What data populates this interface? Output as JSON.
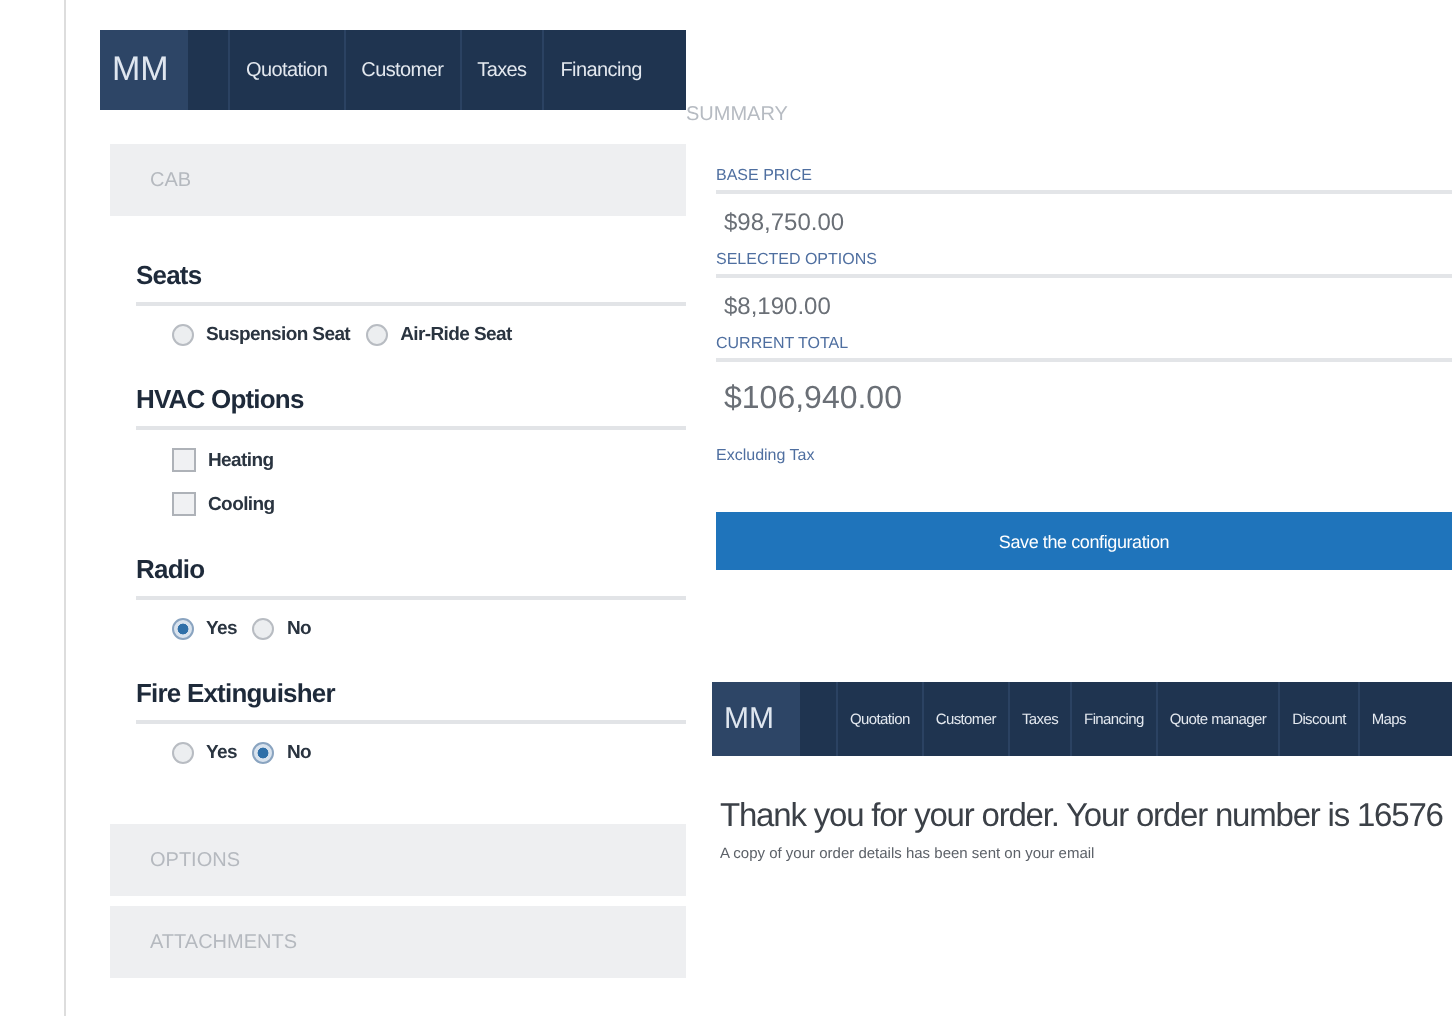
{
  "configurator": {
    "nav": {
      "logo": "MM",
      "items": [
        "Quotation",
        "Customer",
        "Taxes",
        "Financing"
      ]
    },
    "sections": [
      {
        "title": "CAB",
        "groups": [
          {
            "title": "Seats",
            "kind": "radio",
            "options": [
              {
                "label": "Suspension Seat",
                "selected": false
              },
              {
                "label": "Air-Ride Seat",
                "selected": false
              }
            ]
          },
          {
            "title": "HVAC Options",
            "kind": "checkbox",
            "options": [
              {
                "label": "Heating",
                "checked": false
              },
              {
                "label": "Cooling",
                "checked": false
              }
            ]
          },
          {
            "title": "Radio",
            "kind": "radio",
            "options": [
              {
                "label": "Yes",
                "selected": true
              },
              {
                "label": "No",
                "selected": false
              }
            ]
          },
          {
            "title": "Fire Extinguisher",
            "kind": "radio",
            "options": [
              {
                "label": "Yes",
                "selected": false
              },
              {
                "label": "No",
                "selected": true
              }
            ]
          }
        ]
      },
      {
        "title": "OPTIONS"
      },
      {
        "title": "ATTACHMENTS"
      }
    ]
  },
  "summary": {
    "title": "SUMMARY",
    "items": [
      {
        "label": "BASE PRICE",
        "value": "$98,750.00",
        "kind": "line"
      },
      {
        "label": "SELECTED OPTIONS",
        "value": "$8,190.00",
        "kind": "line"
      },
      {
        "label": "CURRENT TOTAL",
        "value": "$106,940.00",
        "kind": "total"
      }
    ],
    "note": "Excluding Tax",
    "button": "Save the configuration"
  },
  "confirmation": {
    "nav": {
      "logo": "MM",
      "items": [
        "Quotation",
        "Customer",
        "Taxes",
        "Financing",
        "Quote manager",
        "Discount",
        "Maps"
      ]
    },
    "heading": "Thank you for your order. Your order number is 16576",
    "message": "A copy of your order details has been sent on your email"
  }
}
